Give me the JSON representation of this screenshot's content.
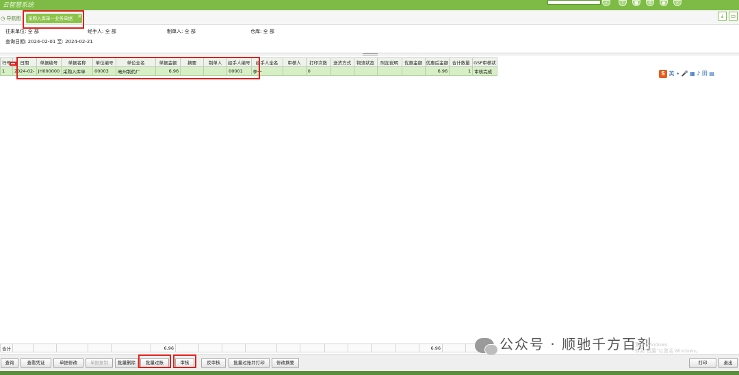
{
  "window": {
    "logo_text": "云智慧系统"
  },
  "tabs": {
    "nav_label": "导航图",
    "active_label": "采购入库单一业务单据",
    "close_glyph": "×"
  },
  "filters": {
    "partner_label": "往来单位:",
    "partner_value": "全  部",
    "handler_label": "经手人:",
    "handler_value": "全  部",
    "maker_label": "制单人:",
    "maker_value": "全  部",
    "warehouse_label": "仓库:",
    "warehouse_value": "全  部",
    "date_label": "查询日期:",
    "date_from": "2024-02-01",
    "date_to_label": "至:",
    "date_to": "2024-02-21"
  },
  "grid": {
    "columns": [
      "行号",
      "日期",
      "单据编号",
      "单据名称",
      "单位编号",
      "单位全名",
      "单据金额",
      "摘要",
      "制单人",
      "经手人编号",
      "经手人全名",
      "审核人",
      "打印次数",
      "送货方式",
      "物流状态",
      "附加说明",
      "优惠金额",
      "优惠后金额",
      "合计数量",
      "GSP审核状"
    ],
    "rows": [
      [
        "1",
        "2024-02-",
        "JH000000",
        "采购入库单",
        "00003",
        "亳州制药厂",
        "6.96",
        "",
        "",
        "00001",
        "李一",
        "",
        "0",
        "",
        "",
        "",
        "",
        "6.96",
        "1",
        "审核完成"
      ]
    ]
  },
  "totals": {
    "label": "合计",
    "amount": "6.96",
    "after_discount": "6.96"
  },
  "toolbar": {
    "buttons": [
      "查询",
      "查看凭证",
      "单据修改",
      "单据复制",
      "批量删除",
      "批量过账",
      "审核",
      "反审核",
      "批量过账并打印",
      "修改摘要"
    ],
    "print": "打印",
    "exit": "退出"
  },
  "ime": {
    "logo": "S",
    "label": "英"
  },
  "watermark": {
    "text": "公众号 · 顺驰千方百剂",
    "activate": "激活 Windows",
    "activate_sub": "转到\"设置\"以激活 Windows。"
  },
  "colors": {
    "brand_green": "#7dbb46",
    "row_green": "#d6efc4",
    "highlight_red": "#e0201c"
  }
}
